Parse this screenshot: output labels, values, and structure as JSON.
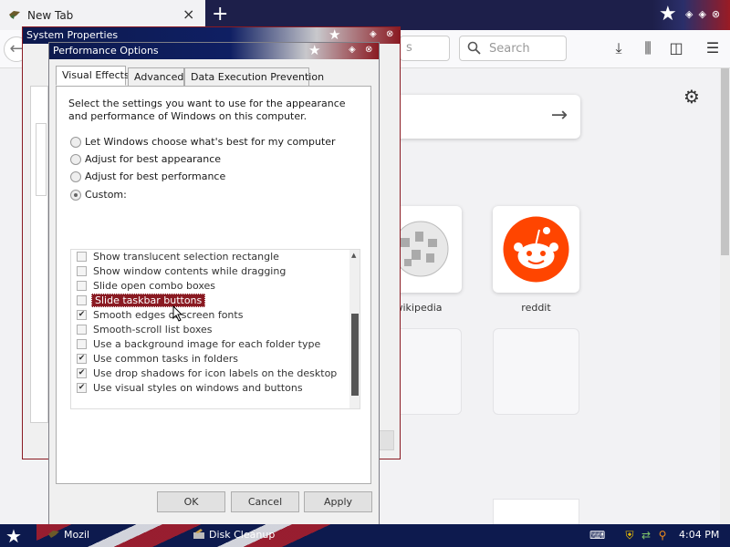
{
  "browser": {
    "tab_title": "New Tab",
    "tab_close": "×",
    "new_tab": "+",
    "url_fragment": "s",
    "search_placeholder": "Search"
  },
  "newtab": {
    "tiles": [
      {
        "label": "wikipedia",
        "icon": "wikipedia-globe-icon"
      },
      {
        "label": "reddit",
        "icon": "reddit-alien-icon"
      }
    ]
  },
  "system_properties": {
    "title": "System Properties"
  },
  "perf": {
    "title": "Performance Options",
    "tabs": [
      "Visual Effects",
      "Advanced",
      "Data Execution Prevention"
    ],
    "description": "Select the settings you want to use for the appearance and performance of Windows on this computer.",
    "radios": [
      {
        "label": "Let Windows choose what's best for my computer",
        "selected": false
      },
      {
        "label": "Adjust for best appearance",
        "selected": false
      },
      {
        "label": "Adjust for best performance",
        "selected": false
      },
      {
        "label": "Custom:",
        "selected": true
      }
    ],
    "items": [
      {
        "label": "Show translucent selection rectangle",
        "checked": false
      },
      {
        "label": "Show window contents while dragging",
        "checked": false
      },
      {
        "label": "Slide open combo boxes",
        "checked": false
      },
      {
        "label": "Slide taskbar buttons",
        "checked": false,
        "highlighted": true
      },
      {
        "label": "Smooth edges of screen fonts",
        "checked": true
      },
      {
        "label": "Smooth-scroll list boxes",
        "checked": false
      },
      {
        "label": "Use a background image for each folder type",
        "checked": false
      },
      {
        "label": "Use common tasks in folders",
        "checked": true
      },
      {
        "label": "Use drop shadows for icon labels on the desktop",
        "checked": true
      },
      {
        "label": "Use visual styles on windows and buttons",
        "checked": true
      }
    ],
    "buttons": {
      "ok": "OK",
      "cancel": "Cancel",
      "apply": "Apply"
    }
  },
  "taskbar": {
    "items": [
      "Mozil",
      "Disk Cleanup"
    ],
    "clock": "4:04 PM"
  },
  "colors": {
    "accent": "#8a1a22",
    "navy": "#0d1a4e"
  }
}
